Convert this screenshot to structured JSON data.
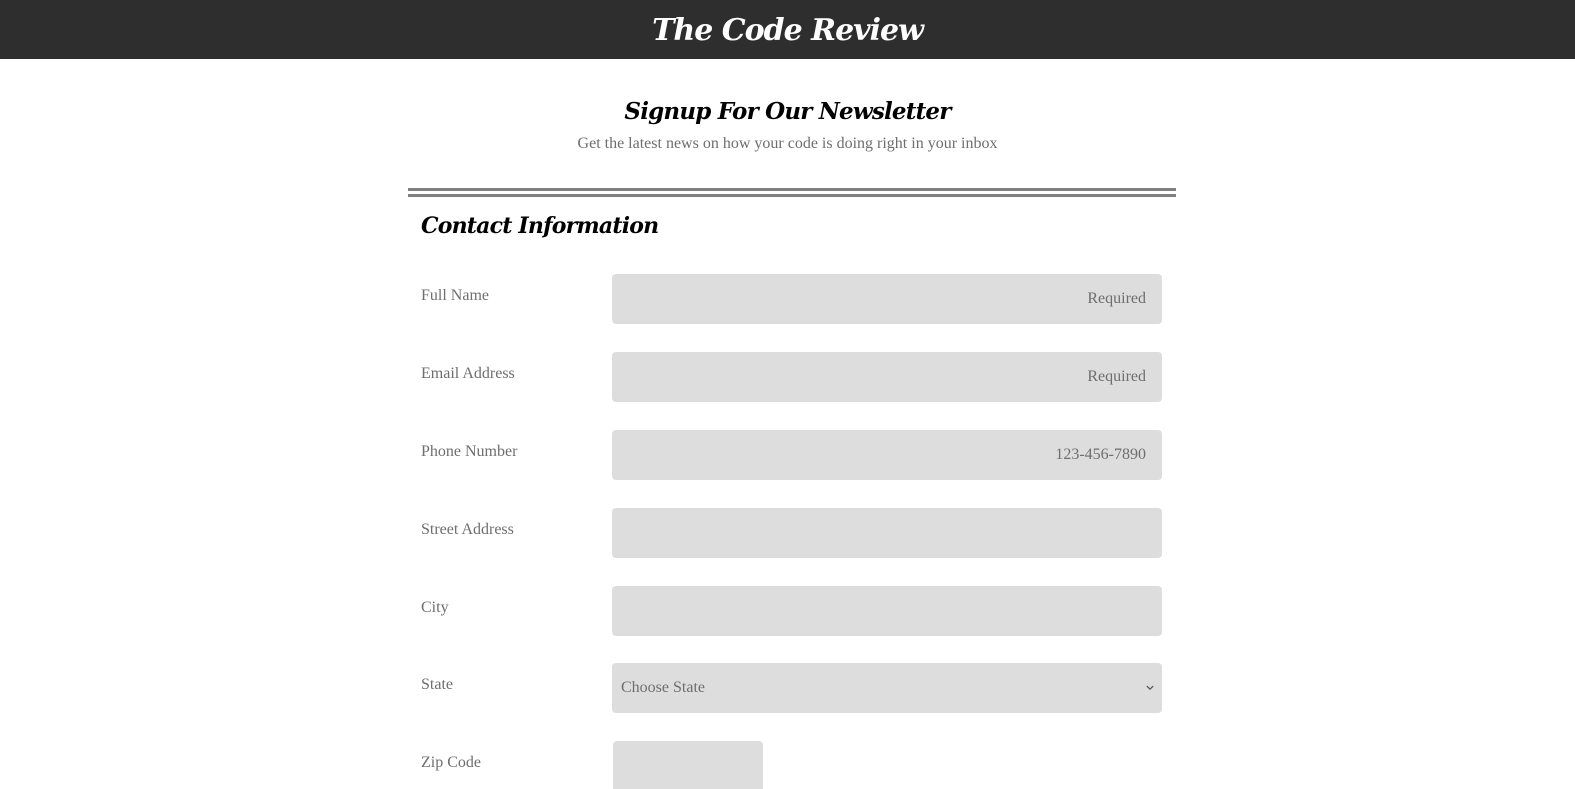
{
  "header": {
    "site_title": "The Code Review"
  },
  "intro": {
    "heading": "Signup For Our Newsletter",
    "subheading": "Get the latest news on how your code is doing right in your inbox"
  },
  "contact": {
    "section_title": "Contact Information",
    "fields": {
      "full_name": {
        "label": "Full Name",
        "placeholder": "Required"
      },
      "email": {
        "label": "Email Address",
        "placeholder": "Required"
      },
      "phone": {
        "label": "Phone Number",
        "placeholder": "123-456-7890"
      },
      "street": {
        "label": "Street Address",
        "placeholder": ""
      },
      "city": {
        "label": "City",
        "placeholder": ""
      },
      "state": {
        "label": "State",
        "selected": "Choose State"
      },
      "zip": {
        "label": "Zip Code",
        "placeholder": ""
      }
    }
  },
  "icons": {
    "state_dropdown": "chevron-down-icon"
  },
  "colors": {
    "topbar_bg": "#2e2e2e",
    "field_bg": "#dddddd",
    "muted_text": "#6e6e6e",
    "divider": "#808080"
  }
}
